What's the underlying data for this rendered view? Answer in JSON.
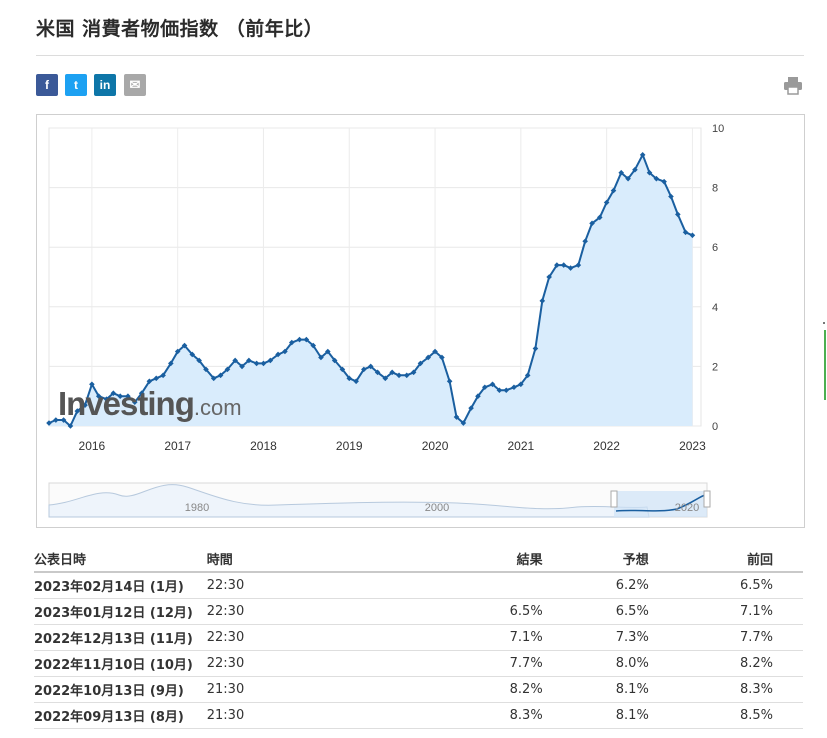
{
  "page": {
    "title": "米国 消費者物価指数 （前年比）"
  },
  "share": {
    "facebook": {
      "label": "f",
      "icon": "facebook-icon",
      "color": "#3b5998"
    },
    "twitter": {
      "label": "t",
      "icon": "twitter-icon",
      "color": "#1da1f2"
    },
    "linkedin": {
      "label": "in",
      "icon": "linkedin-icon",
      "color": "#0e76a8"
    },
    "email": {
      "label": "✉",
      "icon": "email-icon",
      "color": "#a8a8a8"
    },
    "print": {
      "icon": "print-icon"
    }
  },
  "watermark": {
    "brand": "Investing",
    "domain": ".com"
  },
  "chart_data": {
    "type": "area",
    "x_ticks": [
      "2016",
      "2017",
      "2018",
      "2019",
      "2020",
      "2021",
      "2022",
      "2023"
    ],
    "y_ticks": [
      "0",
      "2",
      "4",
      "6",
      "8",
      "10"
    ],
    "ylim": [
      0,
      10
    ],
    "xlim": [
      2015.5,
      2023.1
    ],
    "grid": true,
    "y_axis_side": "right",
    "line_color": "#1a5fa0",
    "fill_color": "#d9ecfc",
    "series": [
      {
        "x": [
          2015.5,
          2015.58,
          2015.67,
          2015.75,
          2015.83,
          2015.92,
          2016.0,
          2016.08,
          2016.17,
          2016.25,
          2016.33,
          2016.42,
          2016.5,
          2016.58,
          2016.67,
          2016.75,
          2016.83,
          2016.92,
          2017.0,
          2017.08,
          2017.17,
          2017.25,
          2017.33,
          2017.42,
          2017.5,
          2017.58,
          2017.67,
          2017.75,
          2017.83,
          2017.92,
          2018.0,
          2018.08,
          2018.17,
          2018.25,
          2018.33,
          2018.42,
          2018.5,
          2018.58,
          2018.67,
          2018.75,
          2018.83,
          2018.92,
          2019.0,
          2019.08,
          2019.17,
          2019.25,
          2019.33,
          2019.42,
          2019.5,
          2019.58,
          2019.67,
          2019.75,
          2019.83,
          2019.92,
          2020.0,
          2020.08,
          2020.17,
          2020.25,
          2020.33,
          2020.42,
          2020.5,
          2020.58,
          2020.67,
          2020.75,
          2020.83,
          2020.92,
          2021.0,
          2021.08,
          2021.17,
          2021.25,
          2021.33,
          2021.42,
          2021.5,
          2021.58,
          2021.67,
          2021.75,
          2021.83,
          2021.92,
          2022.0,
          2022.08,
          2022.17,
          2022.25,
          2022.33,
          2022.42,
          2022.5,
          2022.58,
          2022.67,
          2022.75,
          2022.83,
          2022.92,
          2023.0
        ],
        "values": [
          0.1,
          0.2,
          0.2,
          0.0,
          0.5,
          0.7,
          1.4,
          1.0,
          0.9,
          1.1,
          1.0,
          1.0,
          0.8,
          1.1,
          1.5,
          1.6,
          1.7,
          2.1,
          2.5,
          2.7,
          2.4,
          2.2,
          1.9,
          1.6,
          1.7,
          1.9,
          2.2,
          2.0,
          2.2,
          2.1,
          2.1,
          2.2,
          2.4,
          2.5,
          2.8,
          2.9,
          2.9,
          2.7,
          2.3,
          2.5,
          2.2,
          1.9,
          1.6,
          1.5,
          1.9,
          2.0,
          1.8,
          1.6,
          1.8,
          1.7,
          1.7,
          1.8,
          2.1,
          2.3,
          2.5,
          2.3,
          1.5,
          0.3,
          0.1,
          0.6,
          1.0,
          1.3,
          1.4,
          1.2,
          1.2,
          1.3,
          1.4,
          1.7,
          2.6,
          4.2,
          5.0,
          5.4,
          5.4,
          5.3,
          5.4,
          6.2,
          6.8,
          7.0,
          7.5,
          7.9,
          8.5,
          8.3,
          8.6,
          9.1,
          8.5,
          8.3,
          8.2,
          7.7,
          7.1,
          6.5,
          6.4
        ]
      }
    ],
    "navigator": {
      "ticks": [
        "1980",
        "2000",
        "2020"
      ]
    }
  },
  "table": {
    "headers": {
      "date": "公表日時",
      "time": "時間",
      "actual": "結果",
      "forecast": "予想",
      "previous": "前回"
    },
    "rows": [
      {
        "date": "2023年02月14日 (1月)",
        "time": "22:30",
        "actual": "",
        "forecast": "6.2%",
        "previous": "6.5%",
        "status": ""
      },
      {
        "date": "2023年01月12日 (12月)",
        "time": "22:30",
        "actual": "6.5%",
        "forecast": "6.5%",
        "previous": "7.1%",
        "status": ""
      },
      {
        "date": "2022年12月13日 (11月)",
        "time": "22:30",
        "actual": "7.1%",
        "forecast": "7.3%",
        "previous": "7.7%",
        "status": "up"
      },
      {
        "date": "2022年11月10日 (10月)",
        "time": "22:30",
        "actual": "7.7%",
        "forecast": "8.0%",
        "previous": "8.2%",
        "status": "up"
      },
      {
        "date": "2022年10月13日 (9月)",
        "time": "21:30",
        "actual": "8.2%",
        "forecast": "8.1%",
        "previous": "8.3%",
        "status": "down"
      },
      {
        "date": "2022年09月13日 (8月)",
        "time": "21:30",
        "actual": "8.3%",
        "forecast": "8.1%",
        "previous": "8.5%",
        "status": "down"
      }
    ]
  }
}
